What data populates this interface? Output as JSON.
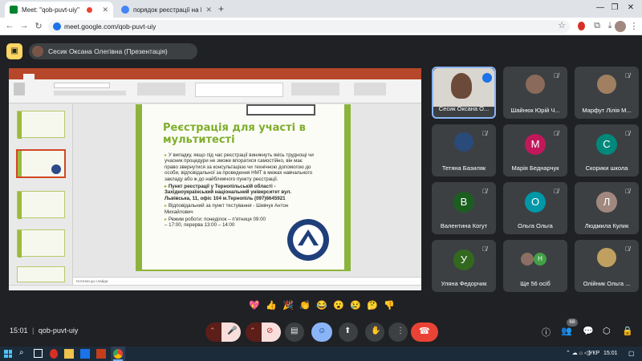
{
  "browser": {
    "tabs": [
      {
        "title": "Meet: \"qob-puvt-uiy\"",
        "active": true
      },
      {
        "title": "порядок реєстрації на НМТ-2",
        "active": false
      }
    ],
    "new_tab": "+",
    "url": "meet.google.com/qob-puvt-uiy"
  },
  "meet": {
    "presenter_label": "Сесик Оксана Олегівна (Презентація)",
    "meeting_time": "15:01",
    "meeting_code": "qob-puvt-uiy",
    "participants_count": "68",
    "accent_red": "#ea4335",
    "accent_blue": "#8ab4f8"
  },
  "slide": {
    "title": "Реєстрація для участі в мультитесті",
    "bullets": [
      "У випадку, якщо під час реєстрації виникнуть якісь труднощі чи учасник процедури не зможе впоратися самостійно, він має право звернутися за консультацією чи технічною допомогою до особи, відповідальної за проведення НМТ в межах навчального закладу або ж до найближчого пункту реєстрації.",
      "Пункт реєстрації у Тернопільській області - Західноукраїнський національний університет вул. Львівська, 11, офіс 104 м.Тернопіль (097)6645921",
      "Відповідальний за пункт тестування - Шевчук Антон Михайлович",
      "Режим роботи: понеділок – п'ятниця 09:00 – 17:00, перерва 13:00 – 14:00"
    ],
    "notes_placeholder": "Нотатки до слайда"
  },
  "participants": [
    {
      "name": "Сесик Оксана О...",
      "kind": "photo",
      "color": "#6b4a3a"
    },
    {
      "name": "Шайнюк Юрій Ч...",
      "kind": "photo",
      "color": "#8a6a5a"
    },
    {
      "name": "Марфут Лілія М...",
      "kind": "photo",
      "color": "#a08060"
    },
    {
      "name": "Тетяна Базиляк",
      "kind": "photo",
      "color": "#2a4a7a"
    },
    {
      "name": "Марія Беднарчук",
      "kind": "avatar",
      "letter": "М",
      "color": "#c2185b"
    },
    {
      "name": "Скорики школа",
      "kind": "avatar",
      "letter": "С",
      "color": "#00897b"
    },
    {
      "name": "Валентина Когут",
      "kind": "avatar",
      "letter": "В",
      "color": "#1b5e20"
    },
    {
      "name": "Ольга Ольга",
      "kind": "avatar",
      "letter": "О",
      "color": "#0097a7"
    },
    {
      "name": "Людмила Кулик",
      "kind": "avatar",
      "letter": "Л",
      "color": "#a1887f"
    },
    {
      "name": "Уляна Федорчик",
      "kind": "avatar",
      "letter": "У",
      "color": "#33691e"
    },
    {
      "name": "Ще 56 осіб",
      "kind": "group"
    },
    {
      "name": "Олійник Ольга ...",
      "kind": "photo",
      "color": "#c0a060"
    }
  ],
  "reactions": [
    "💖",
    "👍",
    "🎉",
    "👏",
    "😂",
    "😮",
    "😢",
    "🤔",
    "👎"
  ],
  "taskbar": {
    "language": "УКР",
    "time": "15:01"
  }
}
